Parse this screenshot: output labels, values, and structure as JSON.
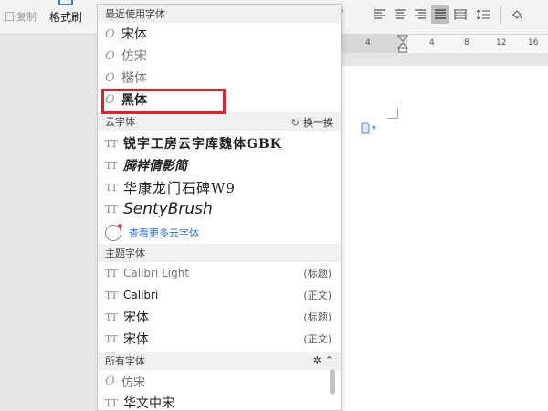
{
  "toolbar": {
    "copy_label": "复制",
    "format_painter_label": "格式刷",
    "font_size_glyph": "A",
    "tool_icons": [
      "align-left-icon",
      "align-center-icon",
      "align-right-icon",
      "justify-icon",
      "distributed-icon",
      "line-spacing-icon",
      "highlight-fill-icon"
    ]
  },
  "ruler": {
    "marks": [
      "4",
      "4",
      "8",
      "12",
      "16"
    ]
  },
  "font_dropdown": {
    "recent_header": "最近使用字体",
    "recent": [
      "宋体",
      "仿宋",
      "楷体",
      "黑体"
    ],
    "cloud_header": "云字体",
    "cloud_action": "换一换",
    "cloud_fonts": [
      "锐字工房云字库魏体GBK",
      "腾祥倩影简",
      "华康龙门石碑W9",
      "SentyBrush"
    ],
    "more_cloud": "查看更多云字体",
    "theme_header": "主题字体",
    "theme_fonts": [
      {
        "name": "Calibri Light",
        "tag": "(标题)"
      },
      {
        "name": "Calibri",
        "tag": "(正文)"
      },
      {
        "name": "宋体",
        "tag": "(标题)"
      },
      {
        "name": "宋体",
        "tag": "(正文)"
      }
    ],
    "all_header": "所有字体",
    "all_fonts": [
      "仿宋",
      "华文中宋"
    ]
  },
  "colors": {
    "highlight_border": "#d9232d",
    "link": "#2b6ed2",
    "accent": "#3a7bd5"
  }
}
